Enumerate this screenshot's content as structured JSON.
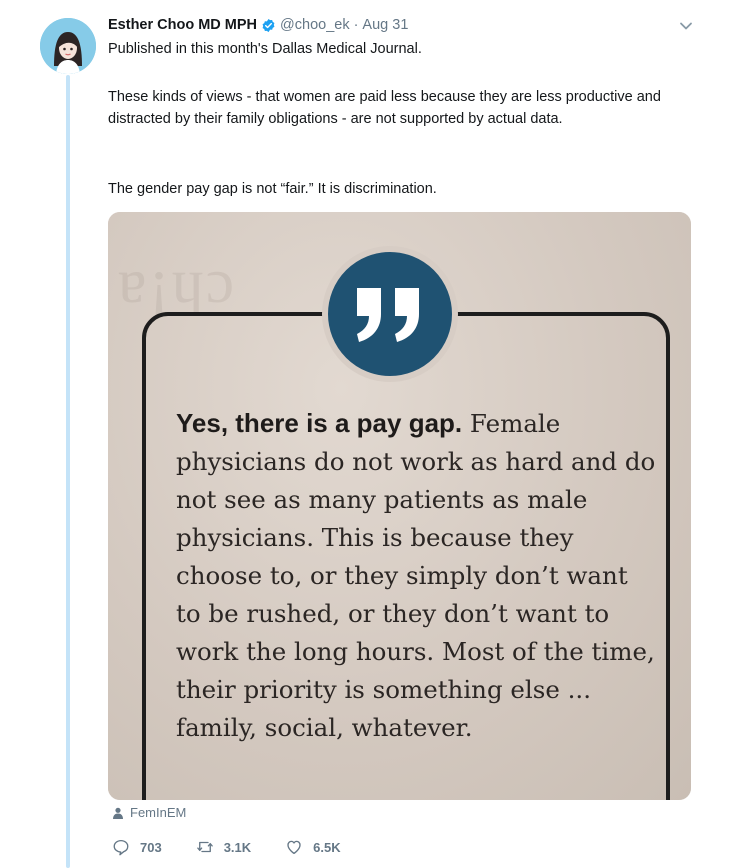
{
  "tweet": {
    "author_name": "Esther Choo MD MPH",
    "handle": "@choo_ek",
    "separator": "·",
    "date": "Aug 31",
    "text_lines": [
      "Published in this month's Dallas Medical Journal.",
      "These kinds of views - that women are paid less because they are less productive and distracted by their family obligations - are not supported by actual data.",
      "The gender pay gap is not “fair.” It is discrimination."
    ]
  },
  "photo": {
    "quote_lead": "Yes, there is a pay gap.",
    "quote_body": " Female physicians do not work as hard and do not see as many patients as male physicians. This is because they choose to, or they simply don’t want to be rushed, or they don’t want to work the long hours. Most of the time, their priority is something else ... family, social, whatever.",
    "quote_glyph": "”",
    "accent_color": "#1f5272"
  },
  "media_tag": "FemInEM",
  "actions": {
    "replies": "703",
    "retweets": "3.1K",
    "likes": "6.5K"
  },
  "colors": {
    "thread_line": "#c4e3f8",
    "verified": "#1da1f2",
    "muted": "#657786"
  }
}
